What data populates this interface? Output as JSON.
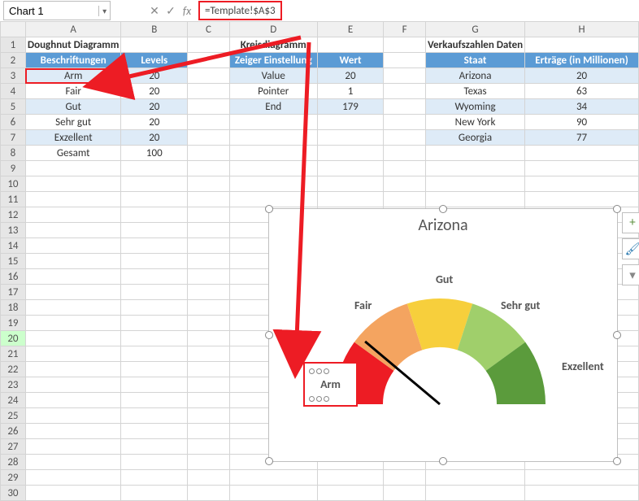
{
  "nameBox": "Chart 1",
  "formula": "=Template!$A$3",
  "columns": [
    "A",
    "B",
    "C",
    "D",
    "E",
    "F",
    "G",
    "H"
  ],
  "sections": {
    "doughnut": {
      "title": "Doughnut Diagramm",
      "h1": "Beschriftungen",
      "h2": "Levels",
      "rows": [
        [
          "Arm",
          "20"
        ],
        [
          "Fair",
          "20"
        ],
        [
          "Gut",
          "20"
        ],
        [
          "Sehr gut",
          "20"
        ],
        [
          "Exzellent",
          "20"
        ],
        [
          "Gesamt",
          "100"
        ]
      ]
    },
    "kreis": {
      "title": "Kreisdiagramm",
      "h1": "Zeiger Einstellung",
      "h2": "Wert",
      "rows": [
        [
          "Value",
          "20"
        ],
        [
          "Pointer",
          "1"
        ],
        [
          "End",
          "179"
        ]
      ]
    },
    "verkauf": {
      "title": "Verkaufszahlen Daten",
      "h1": "Staat",
      "h2": "Erträge (in Millionen)",
      "rows": [
        [
          "Arizona",
          "20"
        ],
        [
          "Texas",
          "63"
        ],
        [
          "Wyoming",
          "34"
        ],
        [
          "New York",
          "90"
        ],
        [
          "Georgia",
          "77"
        ]
      ]
    }
  },
  "chart": {
    "title": "Arizona",
    "labels": {
      "arm": "Arm",
      "fair": "Fair",
      "gut": "Gut",
      "sg": "Sehr gut",
      "ex": "Exzellent"
    }
  },
  "sideIcons": {
    "plus": "+",
    "brush": "🖌",
    "filter": "▾"
  },
  "chart_data": {
    "type": "pie",
    "title": "Arizona",
    "categories": [
      "Arm",
      "Fair",
      "Gut",
      "Sehr gut",
      "Exzellent"
    ],
    "values": [
      20,
      20,
      20,
      20,
      20
    ],
    "pointer": {
      "value": 20,
      "pointer": 1,
      "end": 179
    },
    "colors": [
      "#ed1c24",
      "#f4a460",
      "#f7cf3c",
      "#a0cf6b",
      "#5b9b3c"
    ]
  }
}
